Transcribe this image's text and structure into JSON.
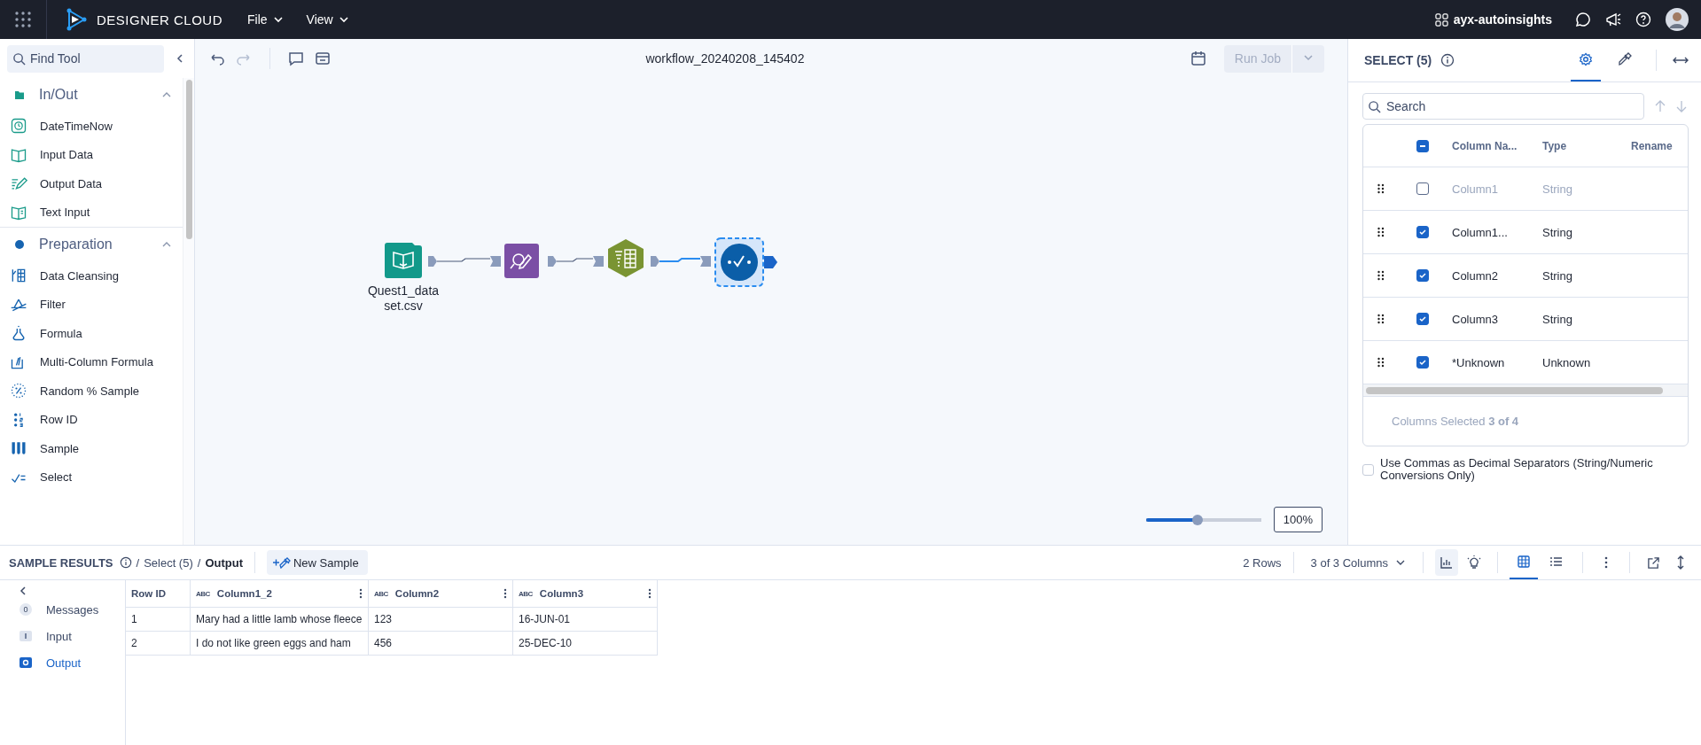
{
  "topbar": {
    "brand": "DESIGNER CLOUD",
    "menus": [
      "File",
      "View"
    ],
    "workspace": "ayx-autoinsights"
  },
  "tool_palette": {
    "search_placeholder": "Find Tool",
    "categories": [
      {
        "name": "In/Out",
        "expanded": true,
        "color": "#1a9b8a",
        "tools": [
          "DateTimeNow",
          "Input Data",
          "Output Data",
          "Text Input"
        ]
      },
      {
        "name": "Preparation",
        "expanded": true,
        "color": "#1664b0",
        "tools": [
          "Data Cleansing",
          "Filter",
          "Formula",
          "Multi-Column Formula",
          "Random % Sample",
          "Row ID",
          "Sample",
          "Select"
        ]
      }
    ]
  },
  "canvas": {
    "title": "workflow_20240208_145402",
    "run_button": {
      "label": "Run Job",
      "disabled": true
    },
    "nodes": [
      {
        "kind": "input",
        "label_lines": [
          "Quest1_data",
          "set.csv"
        ],
        "selected": false
      },
      {
        "kind": "select",
        "selected": false
      },
      {
        "kind": "prep",
        "selected": false
      },
      {
        "kind": "check",
        "selected": true
      }
    ],
    "zoom": {
      "level": 0.45,
      "reading": "100%"
    }
  },
  "config_panel": {
    "title": "SELECT (5)",
    "tabs": [
      {
        "kind": "settings",
        "selected": true
      },
      {
        "kind": "pin",
        "selected": false
      }
    ],
    "search_placeholder": "Search",
    "header_indeterminate": true,
    "columns": [
      "Column Na...",
      "Type",
      "Rename"
    ],
    "rows": [
      {
        "name": "Column1",
        "type": "String",
        "checked": false
      },
      {
        "name": "Column1...",
        "type": "String",
        "checked": true
      },
      {
        "name": "Column2",
        "type": "String",
        "checked": true
      },
      {
        "name": "Column3",
        "type": "String",
        "checked": true
      },
      {
        "name": "*Unknown",
        "type": "Unknown",
        "checked": true
      }
    ],
    "footer": "Columns Selected **3 of 4**",
    "option": {
      "label": "Use Commas as Decimal Separators (String/Numeric Conversions Only)",
      "checked": false
    }
  },
  "results": {
    "title": "SAMPLE RESULTS",
    "crumbs": [
      {
        "separator": "/",
        "label": "Select (5)",
        "current": false
      },
      {
        "separator": "/",
        "label": "Output",
        "current": true
      }
    ],
    "new_sample": "New Sample",
    "row_count": "2 Rows",
    "column_picker": "3 of 3 Columns",
    "views": [
      {
        "kind": "grid",
        "selected": true
      },
      {
        "kind": "list",
        "selected": false
      }
    ],
    "nav": [
      {
        "kind": "messages",
        "label": "Messages",
        "badge": "0",
        "selected": false
      },
      {
        "kind": "input",
        "label": "Input",
        "selected": false
      },
      {
        "kind": "output",
        "label": "Output",
        "selected": true
      }
    ],
    "columns": [
      {
        "name": "Row ID"
      },
      {
        "name": "Column1_2",
        "type_glyph": "ABC"
      },
      {
        "name": "Column2",
        "type_glyph": "ABC"
      },
      {
        "name": "Column3",
        "type_glyph": "ABC"
      }
    ],
    "rows": [
      [
        "1",
        "Mary had a little lamb whose fleece",
        "123",
        "16-JUN-01"
      ],
      [
        "2",
        "I do not like green eggs and ham",
        "456",
        "25-DEC-10"
      ]
    ]
  }
}
